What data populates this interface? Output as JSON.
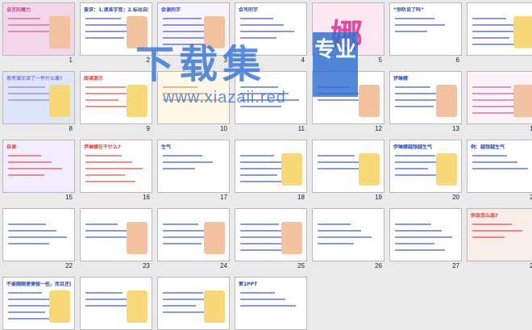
{
  "slides": [
    {
      "num": "1",
      "title": "语言的魔力",
      "bg": "#f4d6ea",
      "accent": "#c24b8f"
    },
    {
      "num": "2",
      "title": "要求：1.读准字音；2.标出自然段；3.找出课文的主人公。",
      "bg": "#ffffff",
      "accent": "#2b48b0"
    },
    {
      "num": "3",
      "title": "会读的字",
      "bg": "#f7f3ff",
      "accent": "#2b48b0"
    },
    {
      "num": "4",
      "title": "会写的字",
      "bg": "#ffffff",
      "accent": "#2b48b0"
    },
    {
      "num": "5",
      "title": "娜",
      "bg": "#fde7f1",
      "accent": "#e64aa0"
    },
    {
      "num": "6",
      "title": "“你听说了吗”",
      "bg": "#ffffff",
      "accent": "#2b48b0"
    },
    {
      "num": "7",
      "title": "",
      "bg": "#ffffff",
      "accent": "#2b48b0"
    },
    {
      "num": "8",
      "title": "思考课文讲了一件什么事?",
      "bg": "#dfe6fb",
      "accent": "#8a73e6"
    },
    {
      "num": "9",
      "title": "阅读提示",
      "bg": "#ffffff",
      "accent": "#d93a3a"
    },
    {
      "num": "10",
      "title": "",
      "bg": "#fff8e9",
      "accent": "#d88a2a"
    },
    {
      "num": "11",
      "title": "",
      "bg": "#ffffff",
      "accent": "#2b48b0"
    },
    {
      "num": "12",
      "title": "",
      "bg": "#ffffff",
      "accent": "#2b48b0"
    },
    {
      "num": "13",
      "title": "伊琳娜",
      "bg": "#ffffff",
      "accent": "#2b48b0"
    },
    {
      "num": "14",
      "title": "",
      "bg": "#fdf3f7",
      "accent": "#c24b8f"
    },
    {
      "num": "15",
      "title": "自读",
      "bg": "#f2ecff",
      "accent": "#d93a3a"
    },
    {
      "num": "16",
      "title": "尹琳娜在干什么?",
      "bg": "#ffffff",
      "accent": "#d93a3a"
    },
    {
      "num": "17",
      "title": "生气",
      "bg": "#ffffff",
      "accent": "#2b48b0"
    },
    {
      "num": "18",
      "title": "",
      "bg": "#ffffff",
      "accent": "#2b48b0"
    },
    {
      "num": "19",
      "title": "",
      "bg": "#ffffff",
      "accent": "#2b48b0"
    },
    {
      "num": "20",
      "title": "伊琳娜越想越生气",
      "bg": "#ffffff",
      "accent": "#2b48b0"
    },
    {
      "num": "21",
      "title": "例：越想越生气",
      "bg": "#ffffff",
      "accent": "#2b48b0"
    },
    {
      "num": "22",
      "title": "",
      "bg": "#ffffff",
      "accent": "#2b48b0"
    },
    {
      "num": "23",
      "title": "",
      "bg": "#ffffff",
      "accent": "#2b48b0"
    },
    {
      "num": "24",
      "title": "",
      "bg": "#ffffff",
      "accent": "#2b48b0"
    },
    {
      "num": "25",
      "title": "",
      "bg": "#ffffff",
      "accent": "#2b48b0"
    },
    {
      "num": "26",
      "title": "",
      "bg": "#ffffff",
      "accent": "#2b48b0"
    },
    {
      "num": "27",
      "title": "",
      "bg": "#ffffff",
      "accent": "#2b48b0"
    },
    {
      "num": "28",
      "title": "你会怎么选?",
      "bg": "#f8ede8",
      "accent": "#d93a3a"
    },
    {
      "num": "29",
      "title": "不要随随便便做一些，而且还要做到一些。",
      "bg": "#ffffff",
      "accent": "#2b48b0"
    },
    {
      "num": "30",
      "title": "",
      "bg": "#ffffff",
      "accent": "#2b48b0"
    },
    {
      "num": "31",
      "title": "",
      "bg": "#ffffff",
      "accent": "#2b48b0"
    },
    {
      "num": "32",
      "title": "第1PPT",
      "bg": "#ffffff",
      "accent": "#2b48b0"
    }
  ],
  "watermark": {
    "main": "下载集",
    "badge": "专业",
    "url": "www.xiazaii.red"
  }
}
